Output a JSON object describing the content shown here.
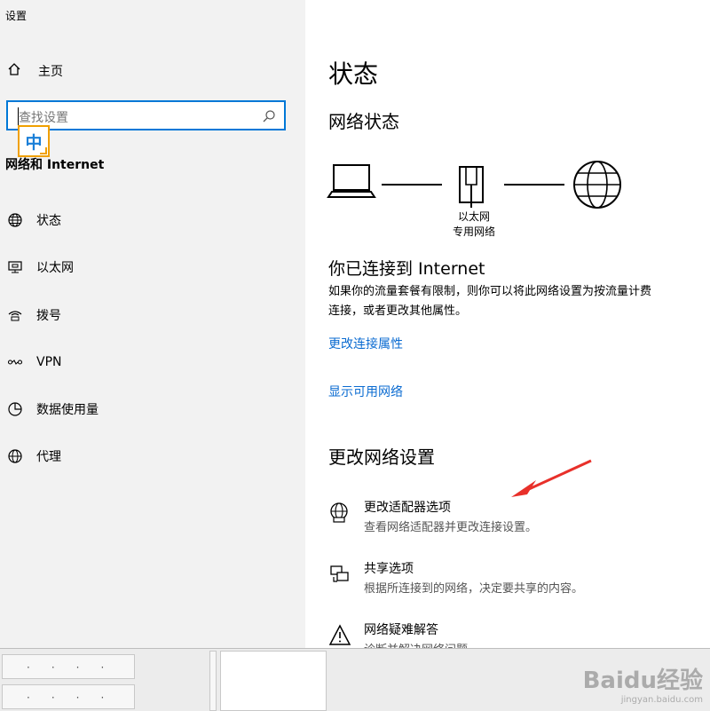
{
  "window": {
    "title": "设置"
  },
  "sidebar": {
    "home_label": "主页",
    "search": {
      "placeholder": "查找设置"
    },
    "ime": {
      "label": "中"
    },
    "section_title": "网络和 Internet",
    "items": [
      {
        "label": "状态",
        "icon": "globe-status-icon"
      },
      {
        "label": "以太网",
        "icon": "ethernet-icon"
      },
      {
        "label": "拨号",
        "icon": "dialup-icon"
      },
      {
        "label": "VPN",
        "icon": "vpn-icon"
      },
      {
        "label": "数据使用量",
        "icon": "data-usage-icon"
      },
      {
        "label": "代理",
        "icon": "globe-proxy-icon"
      }
    ]
  },
  "main": {
    "title": "状态",
    "network_status_heading": "网络状态",
    "adapter": {
      "name": "以太网",
      "type": "专用网络"
    },
    "connected_title": "你已连接到 Internet",
    "connected_desc_line1": "如果你的流量套餐有限制，则你可以将此网络设置为按流量计费",
    "connected_desc_line2": "连接，或者更改其他属性。",
    "link_change_props": "更改连接属性",
    "link_show_networks": "显示可用网络",
    "change_settings_heading": "更改网络设置",
    "options": [
      {
        "title": "更改适配器选项",
        "desc": "查看网络适配器并更改连接设置。",
        "icon": "adapter-globe-icon"
      },
      {
        "title": "共享选项",
        "desc": "根据所连接到的网络，决定要共享的内容。",
        "icon": "sharing-icon"
      },
      {
        "title": "网络疑难解答",
        "desc": "诊断并解决网络问题",
        "icon": "warning-icon"
      }
    ]
  },
  "watermark": {
    "brand": "Baidu经验",
    "url": "jingyan.baidu.com"
  },
  "colors": {
    "accent": "#0078d7",
    "link": "#0a6bd1",
    "ime_border": "#f0a000",
    "arrow": "#e8302a"
  }
}
